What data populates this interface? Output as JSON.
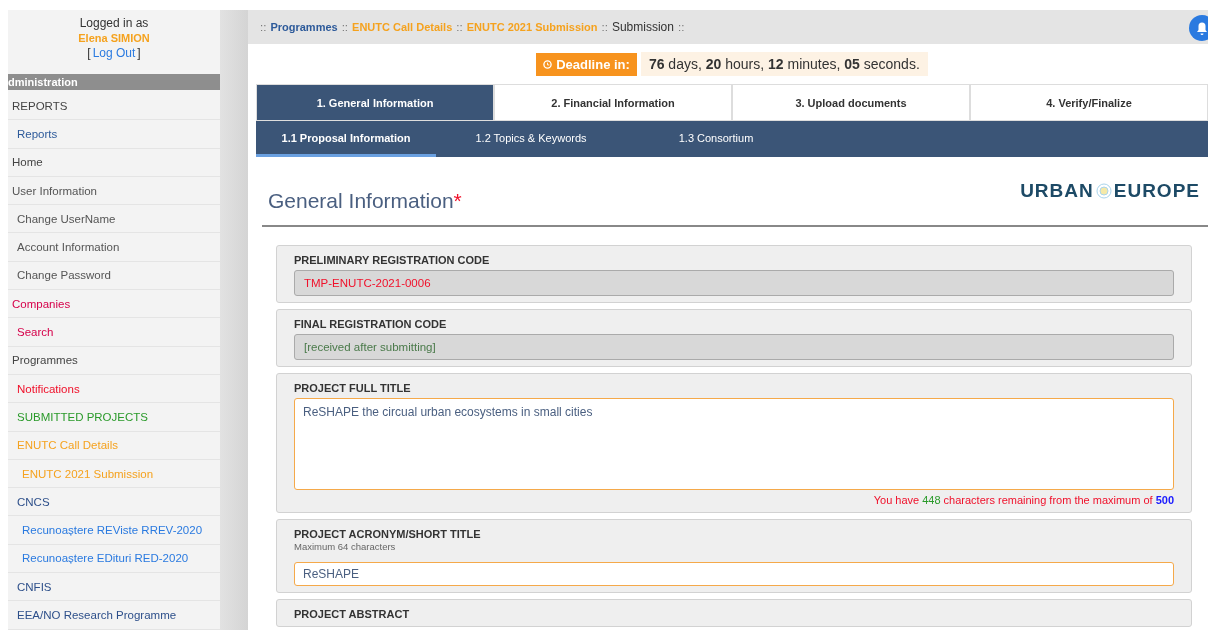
{
  "sidebar": {
    "logged_in_label": "Logged in as",
    "user_name": "Elena SIMION",
    "logout": {
      "open": "[",
      "label": "Log Out",
      "close": "]"
    },
    "section_title": "dministration",
    "items": [
      {
        "label": "REPORTS",
        "color": "#444444",
        "children": [
          {
            "label": "Reports",
            "color": "#2d5a9a"
          }
        ]
      },
      {
        "label": "Home",
        "color": "#444444"
      },
      {
        "label": "User Information",
        "color": "#555555",
        "children": [
          {
            "label": "Change UserName",
            "color": "#555555"
          },
          {
            "label": "Account Information",
            "color": "#555555"
          },
          {
            "label": "Change Password",
            "color": "#555555"
          }
        ]
      },
      {
        "label": "Companies",
        "color": "#d6004a",
        "children": [
          {
            "label": "Search",
            "color": "#d6004a"
          }
        ]
      },
      {
        "label": "Programmes",
        "color": "#444444",
        "children": [
          {
            "label": "Notifications",
            "color": "#f0102a"
          },
          {
            "label": "SUBMITTED PROJECTS",
            "color": "#2a9a2a"
          },
          {
            "label": "ENUTC Call Details",
            "color": "#f5a21e",
            "children": [
              {
                "label": "ENUTC 2021 Submission",
                "color": "#f5a21e"
              }
            ]
          },
          {
            "label": "CNCS",
            "color": "#2d4f8a",
            "children": [
              {
                "label": "Recunoaștere REViste RREV-2020",
                "color": "#2a7ae0"
              },
              {
                "label": "Recunoaștere EDituri RED-2020",
                "color": "#2a7ae0"
              }
            ]
          },
          {
            "label": "CNFIS",
            "color": "#2d4f8a"
          },
          {
            "label": "EEA/NO Research Programme",
            "color": "#2d4f8a"
          }
        ]
      }
    ]
  },
  "breadcrumb": [
    {
      "sep": "::",
      "label": "Programmes",
      "color": "#2d5a9a"
    },
    {
      "sep": "::",
      "label": "ENUTC Call Details",
      "color": "#f5a21e"
    },
    {
      "sep": "::",
      "label": "ENUTC 2021 Submission",
      "color": "#f5a21e"
    },
    {
      "sep": "::",
      "label": "Submission",
      "color": "#333333"
    },
    {
      "sep": "::"
    }
  ],
  "deadline": {
    "label": "Deadline in:",
    "value": "**76** days, **20** hours, **12** minutes, **05** seconds."
  },
  "tabs": [
    {
      "label": "1. General Information",
      "selected": true
    },
    {
      "label": "2. Financial Information",
      "selected": false
    },
    {
      "label": "3. Upload documents",
      "selected": false
    },
    {
      "label": "4. Verify/Finalize",
      "selected": false
    }
  ],
  "subtabs": [
    {
      "label": "1.1 Proposal Information",
      "selected": true
    },
    {
      "label": "1.2 Topics & Keywords",
      "selected": false
    },
    {
      "label": "1.3 Consortium",
      "selected": false
    }
  ],
  "heading": {
    "title": "General Information",
    "required_mark": "*"
  },
  "logo": {
    "left": "URBAN",
    "right": "EUROPE"
  },
  "fields": [
    {
      "kind": "readonly",
      "label": "PRELIMINARY REGISTRATION CODE",
      "value": "TMP-ENUTC-2021-0006",
      "color": "#f0102a"
    },
    {
      "kind": "readonly",
      "label": "FINAL REGISTRATION CODE",
      "value": "[received after submitting]",
      "color": "#4a7a4a"
    },
    {
      "kind": "textarea",
      "label": "PROJECT FULL TITLE",
      "value": "ReSHAPE the circual urban ecosystems in small cities",
      "counter": {
        "prefix": "You have",
        "remaining": "448",
        "middle": "characters remaining from the maximum of",
        "max": "500"
      }
    },
    {
      "kind": "input",
      "label": "PROJECT ACRONYM/SHORT TITLE",
      "hint": "Maximum 64 characters",
      "value": "ReSHAPE"
    },
    {
      "kind": "header",
      "label": "PROJECT ABSTRACT"
    }
  ]
}
